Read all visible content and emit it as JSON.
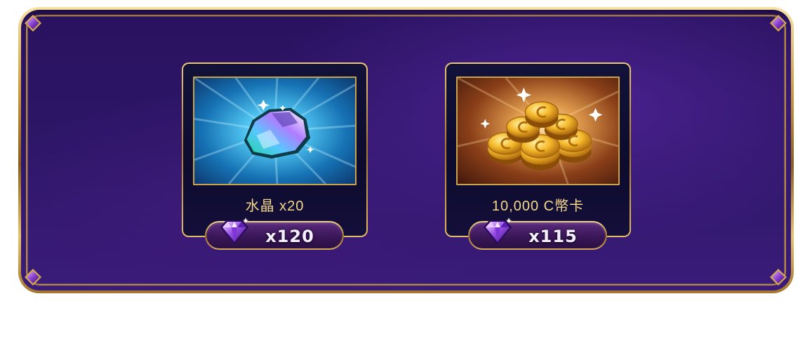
{
  "shop": {
    "items": [
      {
        "name": "水晶 x20",
        "image": "crystal-gem-icon",
        "price": "x120",
        "currency_icon": "purple-diamond-icon"
      },
      {
        "name": "10,000 C幣卡",
        "image": "gold-coins-icon",
        "price": "x115",
        "currency_icon": "purple-diamond-icon"
      }
    ]
  },
  "colors": {
    "panel_bg": "#2e1668",
    "frame_gold": "#c99a3f",
    "item_name": "#f5d98c",
    "price_text": "#f4f0ff"
  }
}
